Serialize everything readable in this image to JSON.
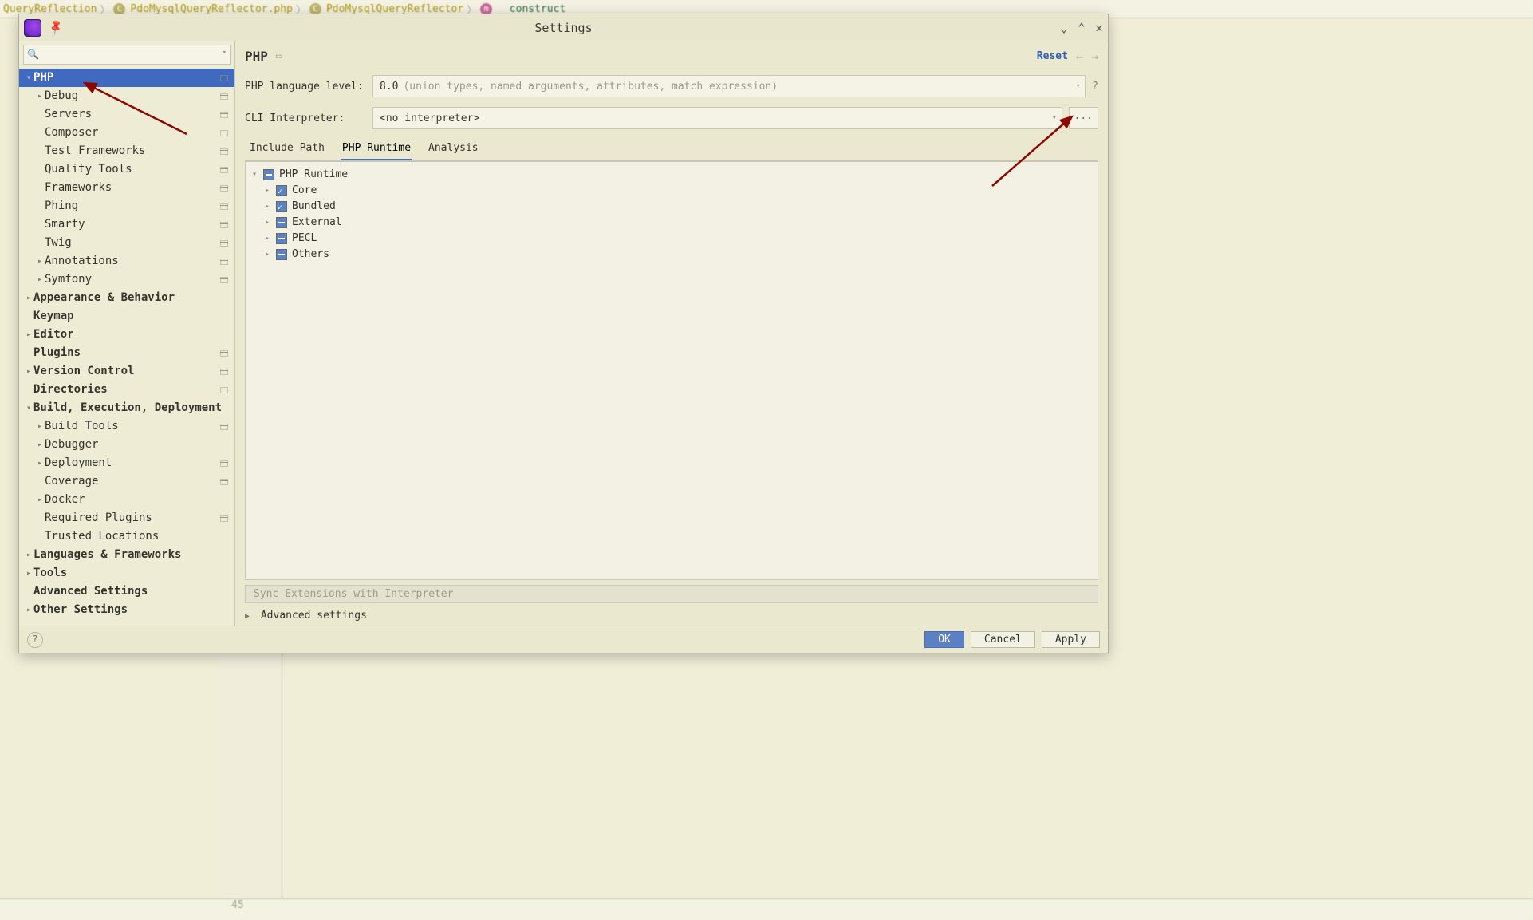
{
  "background": {
    "breadcrumbs": [
      "QueryReflection",
      "PdoMysqlQueryReflector.php",
      "PdoMysqlQueryReflector",
      "__construct"
    ],
    "gutter_line": "45"
  },
  "dialog": {
    "title": "Settings"
  },
  "sidebar": {
    "items": [
      {
        "label": "PHP",
        "bold": true,
        "selected": true,
        "expand": "down",
        "indent": 0,
        "grp": true
      },
      {
        "label": "Debug",
        "expand": "right",
        "indent": 1,
        "grp": true
      },
      {
        "label": "Servers",
        "indent": 1,
        "grp": true
      },
      {
        "label": "Composer",
        "indent": 1,
        "grp": true
      },
      {
        "label": "Test Frameworks",
        "indent": 1,
        "grp": true
      },
      {
        "label": "Quality Tools",
        "indent": 1,
        "grp": true
      },
      {
        "label": "Frameworks",
        "indent": 1,
        "grp": true
      },
      {
        "label": "Phing",
        "indent": 1,
        "grp": true
      },
      {
        "label": "Smarty",
        "indent": 1,
        "grp": true
      },
      {
        "label": "Twig",
        "indent": 1,
        "grp": true
      },
      {
        "label": "Annotations",
        "expand": "right",
        "indent": 1,
        "grp": true
      },
      {
        "label": "Symfony",
        "expand": "right",
        "indent": 1,
        "grp": true
      },
      {
        "label": "Appearance & Behavior",
        "bold": true,
        "expand": "right",
        "indent": 0
      },
      {
        "label": "Keymap",
        "bold": true,
        "indent": 0
      },
      {
        "label": "Editor",
        "bold": true,
        "expand": "right",
        "indent": 0
      },
      {
        "label": "Plugins",
        "bold": true,
        "indent": 0,
        "grp": true
      },
      {
        "label": "Version Control",
        "bold": true,
        "expand": "right",
        "indent": 0,
        "grp": true
      },
      {
        "label": "Directories",
        "bold": true,
        "indent": 0,
        "grp": true
      },
      {
        "label": "Build, Execution, Deployment",
        "bold": true,
        "expand": "down",
        "indent": 0
      },
      {
        "label": "Build Tools",
        "expand": "right",
        "indent": 1,
        "grp": true
      },
      {
        "label": "Debugger",
        "expand": "right",
        "indent": 1
      },
      {
        "label": "Deployment",
        "expand": "right",
        "indent": 1,
        "grp": true
      },
      {
        "label": "Coverage",
        "indent": 1,
        "grp": true
      },
      {
        "label": "Docker",
        "expand": "right",
        "indent": 1
      },
      {
        "label": "Required Plugins",
        "indent": 1,
        "grp": true
      },
      {
        "label": "Trusted Locations",
        "indent": 1
      },
      {
        "label": "Languages & Frameworks",
        "bold": true,
        "expand": "right",
        "indent": 0
      },
      {
        "label": "Tools",
        "bold": true,
        "expand": "right",
        "indent": 0
      },
      {
        "label": "Advanced Settings",
        "bold": true,
        "indent": 0
      },
      {
        "label": "Other Settings",
        "bold": true,
        "expand": "right",
        "indent": 0
      }
    ]
  },
  "header": {
    "title": "PHP",
    "reset": "Reset"
  },
  "form": {
    "lang_label": "PHP language level:",
    "lang_value": "8.0",
    "lang_hint": "(union types, named arguments, attributes, match expression)",
    "cli_label": "CLI Interpreter:",
    "cli_value": "<no interpreter>"
  },
  "tabs": {
    "items": [
      "Include Path",
      "PHP Runtime",
      "Analysis"
    ],
    "active": 1
  },
  "runtime": {
    "root": "PHP Runtime",
    "children": [
      {
        "label": "Core",
        "state": "on"
      },
      {
        "label": "Bundled",
        "state": "on"
      },
      {
        "label": "External",
        "state": "mix"
      },
      {
        "label": "PECL",
        "state": "mix"
      },
      {
        "label": "Others",
        "state": "mix"
      }
    ],
    "sync": "Sync Extensions with Interpreter",
    "advanced": "Advanced settings"
  },
  "footer": {
    "ok": "OK",
    "cancel": "Cancel",
    "apply": "Apply"
  }
}
